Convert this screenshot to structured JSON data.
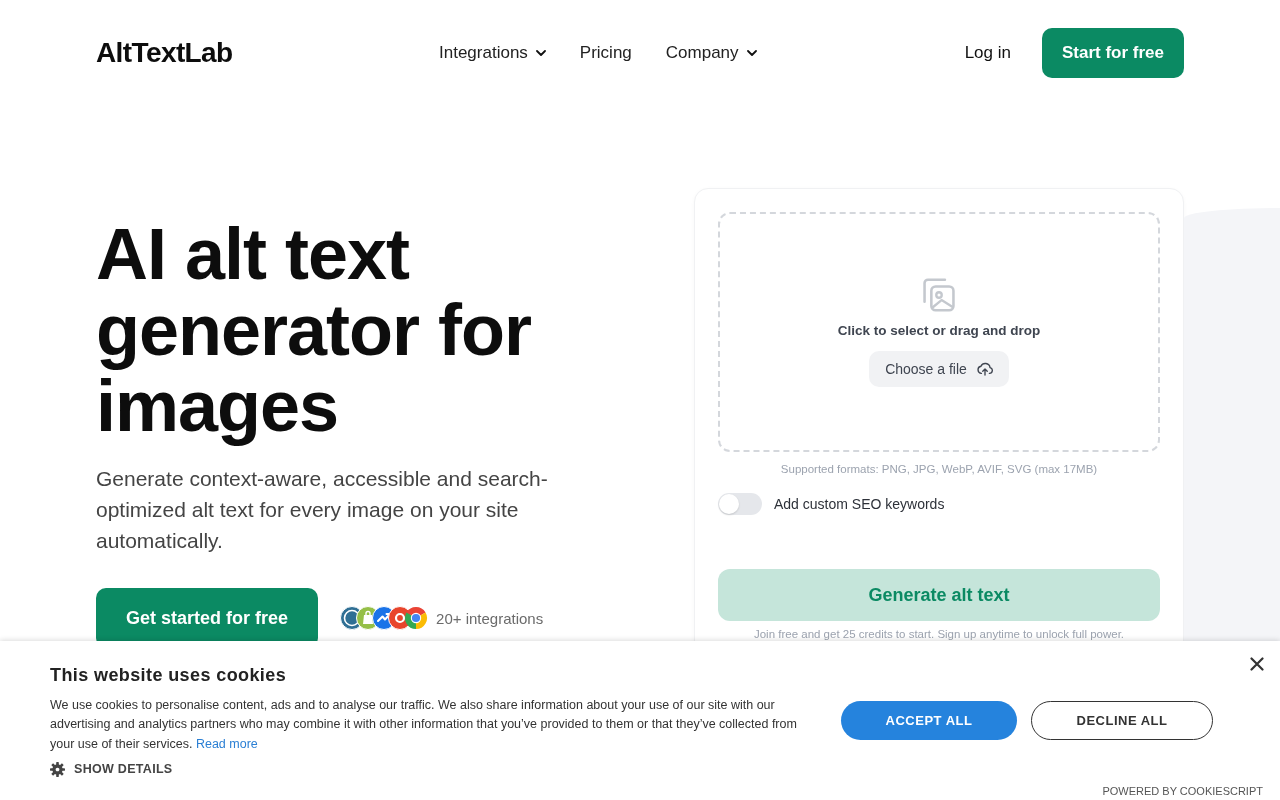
{
  "header": {
    "logo": "AltTextLab",
    "nav": [
      {
        "label": "Integrations",
        "dropdown": true
      },
      {
        "label": "Pricing",
        "dropdown": false
      },
      {
        "label": "Company",
        "dropdown": true
      }
    ],
    "login": "Log in",
    "cta": "Start for free"
  },
  "hero": {
    "title": "AI alt text generator for images",
    "subtitle": "Generate context-aware, accessible and search-optimized alt text for every image on your site automatically.",
    "cta": "Get started for free",
    "integrations": "20+ integrations"
  },
  "uploader": {
    "prompt": "Click to select or drag and drop",
    "choose_file": "Choose a file",
    "formats_note": "Supported formats: PNG, JPG, WebP, AVIF, SVG (max 17MB)",
    "seo_toggle": {
      "label": "Add custom SEO keywords",
      "on": false
    },
    "generate": {
      "label": "Generate alt text",
      "disabled": true
    },
    "footnote": "Join free and get 25 credits to start. Sign up anytime to unlock full power."
  },
  "cookie_banner": {
    "title": "This website uses cookies",
    "text": "We use cookies to personalise content, ads and to analyse our traffic. We also share information about your use of our site with our advertising and analytics partners who may combine it with other information that you’ve provided to them or that they’ve collected from your use of their services.",
    "read_more": "Read more",
    "show_details": "SHOW DETAILS",
    "accept": "ACCEPT ALL",
    "decline": "DECLINE ALL",
    "powered_by": "POWERED BY COOKIESCRIPT"
  }
}
